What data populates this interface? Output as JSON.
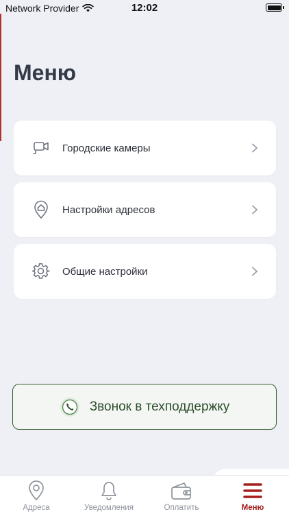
{
  "status_bar": {
    "carrier": "Network Provider",
    "time": "12:02"
  },
  "page": {
    "title": "Меню"
  },
  "menu": {
    "items": [
      {
        "label": "Городские камеры",
        "icon": "camera-icon"
      },
      {
        "label": "Настройки адресов",
        "icon": "location-pin-icon"
      },
      {
        "label": "Общие настройки",
        "icon": "gear-icon"
      }
    ]
  },
  "support": {
    "label": "Звонок в техподдержку",
    "icon": "phone-icon",
    "color": "#2d4d2b"
  },
  "tab_bar": {
    "tabs": [
      {
        "label": "Адреса",
        "icon": "location-pin-icon",
        "active": false
      },
      {
        "label": "Уведомления",
        "icon": "bell-icon",
        "active": false
      },
      {
        "label": "Оплатить",
        "icon": "wallet-icon",
        "active": false
      },
      {
        "label": "Меню",
        "icon": "hamburger-menu-icon",
        "active": true
      }
    ],
    "active_color": "#a3201c",
    "inactive_color": "#8f939c"
  }
}
